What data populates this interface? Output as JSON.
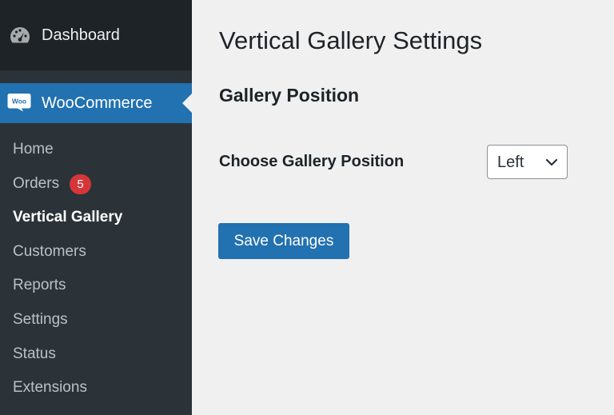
{
  "sidebar": {
    "dashboard": {
      "label": "Dashboard",
      "icon": "dashboard-gauge-icon"
    },
    "woocommerce": {
      "label": "WooCommerce",
      "icon": "woocommerce-logo-icon",
      "logo_text": "Woo"
    },
    "items": [
      {
        "label": "Home",
        "current": false
      },
      {
        "label": "Orders",
        "current": false,
        "badge": "5"
      },
      {
        "label": "Vertical Gallery",
        "current": true
      },
      {
        "label": "Customers",
        "current": false
      },
      {
        "label": "Reports",
        "current": false
      },
      {
        "label": "Settings",
        "current": false
      },
      {
        "label": "Status",
        "current": false
      },
      {
        "label": "Extensions",
        "current": false
      }
    ]
  },
  "main": {
    "page_title": "Vertical Gallery Settings",
    "section_title": "Gallery Position",
    "field": {
      "label": "Choose Gallery Position",
      "selected": "Left",
      "icon": "chevron-down-icon"
    },
    "save_label": "Save Changes"
  },
  "colors": {
    "sidebar_bg": "#2c3338",
    "sidebar_top_bg": "#1d2327",
    "accent": "#2271b1",
    "badge": "#d63638",
    "content_bg": "#f0f0f1"
  }
}
